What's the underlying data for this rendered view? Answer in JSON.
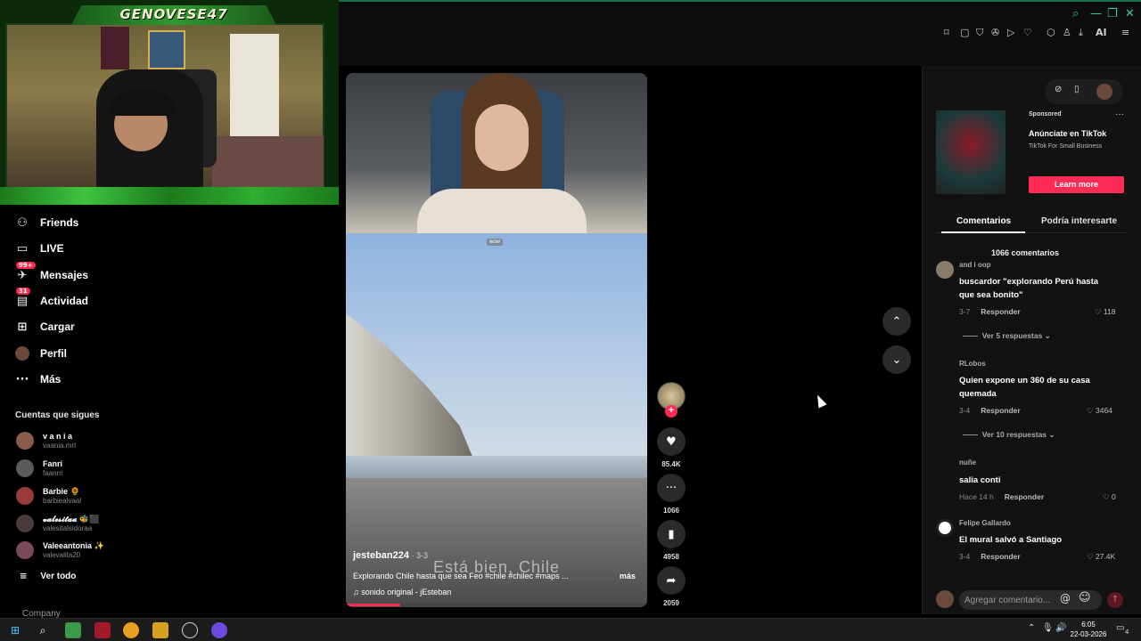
{
  "stream": {
    "name": "GENOVESE47"
  },
  "browser": {
    "window_controls": [
      "search-icon",
      "minimize-icon",
      "restore-icon",
      "close-icon"
    ],
    "extensions": [
      "⌑",
      "▢",
      "⛉",
      "✇",
      "▷",
      "♡",
      "⬡",
      "♙",
      "⤓",
      "AI",
      "≡"
    ]
  },
  "nav": {
    "friends": "Friends",
    "live": "LIVE",
    "messages": "Mensajes",
    "messages_badge": "99+",
    "activity": "Actividad",
    "activity_badge": "31",
    "upload": "Cargar",
    "profile": "Perfil",
    "more": "Más"
  },
  "following": {
    "title": "Cuentas que sigues",
    "accounts": [
      {
        "name": "v a n i a",
        "user": "vaania.mrl"
      },
      {
        "name": "Fanri",
        "user": "faanrri"
      },
      {
        "name": "Barbie 🌻",
        "user": "barbiealvaal"
      },
      {
        "name": "𝓿𝓪𝓵𝓮𝓼𝓲𝓽𝓪𝓪 🐝⬛",
        "user": "valesitalsidoraa"
      },
      {
        "name": "Valeeantonia ✨",
        "user": "valevalita20"
      }
    ],
    "see_all": "Ver todo"
  },
  "footer": {
    "company": "Company"
  },
  "video": {
    "badge": "wow",
    "subtitle": "Está bien, Chile",
    "author": "jesteban224",
    "date": " · 3-3",
    "description": "Explorando Chile hasta que sea Feo #chile #chilec #maps ...",
    "more": "más",
    "music": "♫  sonido original - jEsteban",
    "progress": 0.18,
    "likes": "85.4K",
    "comments": "1066",
    "saves": "4958",
    "shares": "2059"
  },
  "ad": {
    "sponsored": "Sponsored",
    "title": "Anúnciate en TikTok",
    "subtitle": "TikTok For Small Business",
    "cta": "Learn more"
  },
  "tabs": {
    "comments": "Comentarios",
    "related": "Podría interesarte"
  },
  "comments_count": "1066 comentarios",
  "comments": [
    {
      "user": "and i oop",
      "text": "buscardor \"explorando Perú hasta que sea bonito\"",
      "date": "3-7",
      "reply": "Responder",
      "likes": "118",
      "replies": "Ver 5 respuestas"
    },
    {
      "user": "RLobos",
      "text": "Quien expone un 360 de su casa quemada",
      "date": "3-4",
      "reply": "Responder",
      "likes": "3464",
      "replies": "Ver 10 respuestas"
    },
    {
      "user": "nuñe",
      "text": "salia conti",
      "date": "Hace 14 h",
      "reply": "Responder",
      "likes": "0"
    },
    {
      "user": "Felipe Gallardo",
      "text": "El mural salvó a Santiago",
      "date": "3-4",
      "reply": "Responder",
      "likes": "27.4K"
    }
  ],
  "comment_input": {
    "placeholder": "Agregar comentario..."
  },
  "taskbar": {
    "time": "6:05",
    "date": "22-03-2026",
    "notifications": "4"
  },
  "colors": {
    "accent": "#fe2c55",
    "stream_green": "#2fd28e"
  }
}
